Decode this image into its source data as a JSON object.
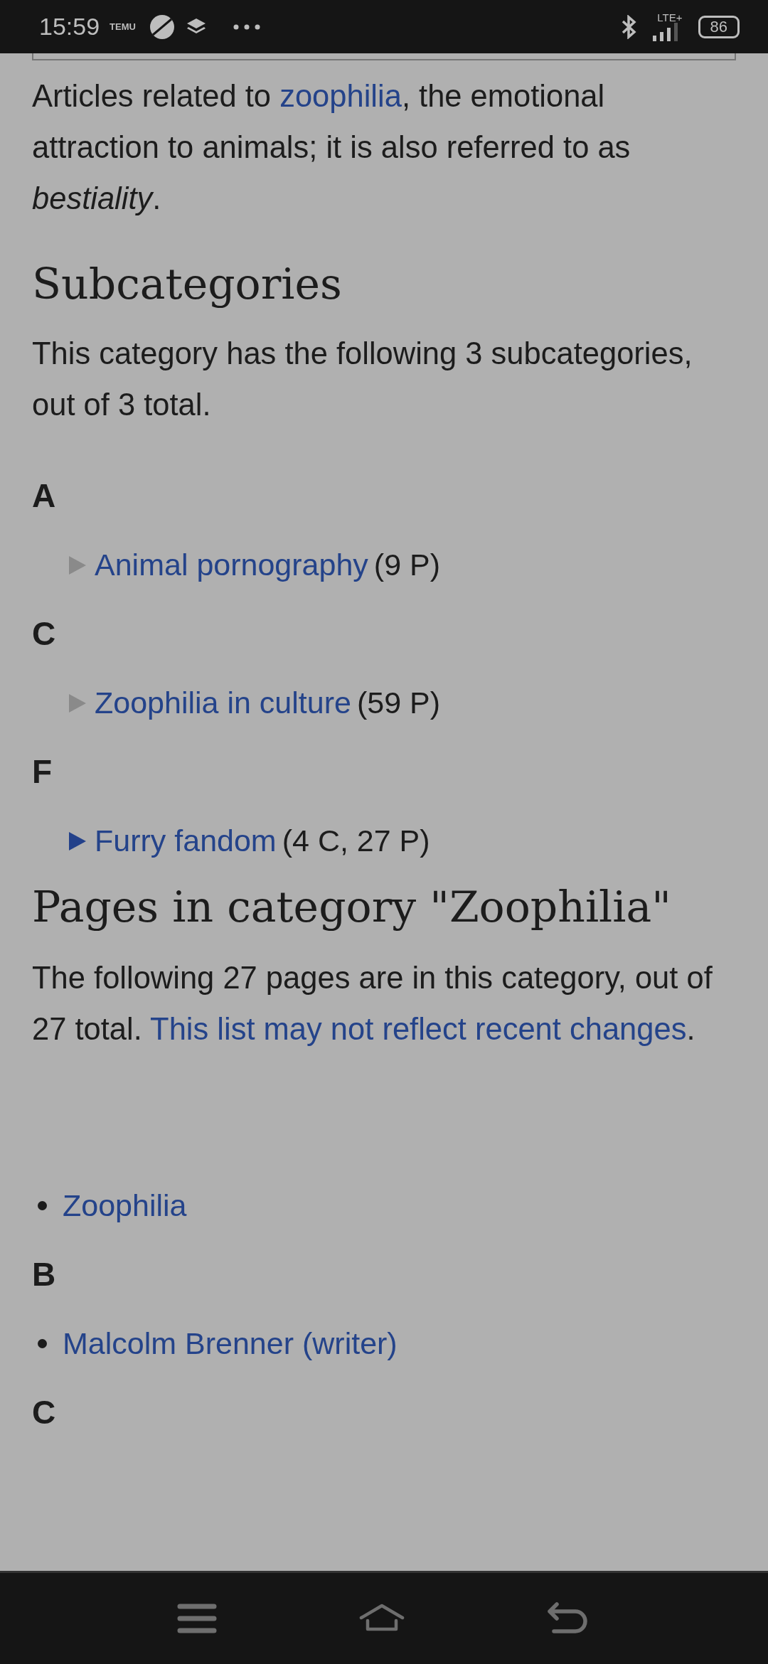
{
  "status_bar": {
    "time": "15:59",
    "notification_text": "TEMU",
    "network": "LTE+",
    "battery": "86"
  },
  "intro": [
    {
      "kind": "text",
      "text": "Articles related to "
    },
    {
      "kind": "link",
      "text": "zoophilia"
    },
    {
      "kind": "text",
      "text": ", the emotional attraction to animals; it is also referred to as "
    },
    {
      "kind": "italic",
      "text": "bestiality"
    },
    {
      "kind": "text",
      "text": "."
    }
  ],
  "subcategories": {
    "heading": "Subcategories",
    "summary": [
      {
        "kind": "text",
        "text": "This category has the following 3 subcategories, out of 3 total."
      }
    ],
    "groups": [
      {
        "letter": "A",
        "items": [
          {
            "link": "Animal pornography",
            "count": "(9 P)",
            "expandable": false
          }
        ]
      },
      {
        "letter": "C",
        "items": [
          {
            "link": "Zoophilia in culture",
            "count": "(59 P)",
            "expandable": false
          }
        ]
      },
      {
        "letter": "F",
        "items": [
          {
            "link": "Furry fandom",
            "count": "(4 C, 27 P)",
            "expandable": true
          }
        ]
      }
    ]
  },
  "pages": {
    "heading": "Pages in category \"Zoophilia\"",
    "summary": [
      {
        "kind": "text",
        "text": "The following 27 pages are in this category, out of 27 total. "
      },
      {
        "kind": "link",
        "text": "This list may not reflect recent changes"
      },
      {
        "kind": "text",
        "text": "."
      }
    ],
    "groups": [
      {
        "items": [
          "Zoophilia"
        ]
      },
      {
        "letter": "B",
        "items": [
          "Malcolm Brenner (writer)"
        ]
      },
      {
        "letter": "C"
      }
    ]
  }
}
